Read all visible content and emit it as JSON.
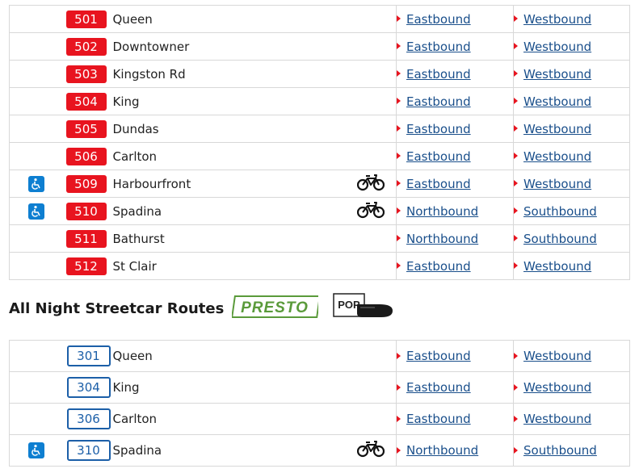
{
  "day_routes": [
    {
      "number": "501",
      "name": "Queen",
      "accessible": false,
      "bike": false,
      "dir1": "Eastbound",
      "dir2": "Westbound"
    },
    {
      "number": "502",
      "name": "Downtowner",
      "accessible": false,
      "bike": false,
      "dir1": "Eastbound",
      "dir2": "Westbound"
    },
    {
      "number": "503",
      "name": "Kingston Rd",
      "accessible": false,
      "bike": false,
      "dir1": "Eastbound",
      "dir2": "Westbound"
    },
    {
      "number": "504",
      "name": "King",
      "accessible": false,
      "bike": false,
      "dir1": "Eastbound",
      "dir2": "Westbound"
    },
    {
      "number": "505",
      "name": "Dundas",
      "accessible": false,
      "bike": false,
      "dir1": "Eastbound",
      "dir2": "Westbound"
    },
    {
      "number": "506",
      "name": "Carlton",
      "accessible": false,
      "bike": false,
      "dir1": "Eastbound",
      "dir2": "Westbound"
    },
    {
      "number": "509",
      "name": "Harbourfront",
      "accessible": true,
      "bike": true,
      "dir1": "Eastbound",
      "dir2": "Westbound"
    },
    {
      "number": "510",
      "name": "Spadina",
      "accessible": true,
      "bike": true,
      "dir1": "Northbound",
      "dir2": "Southbound"
    },
    {
      "number": "511",
      "name": "Bathurst",
      "accessible": false,
      "bike": false,
      "dir1": "Northbound",
      "dir2": "Southbound"
    },
    {
      "number": "512",
      "name": "St Clair",
      "accessible": false,
      "bike": false,
      "dir1": "Eastbound",
      "dir2": "Westbound"
    }
  ],
  "night_section": {
    "title": "All Night Streetcar Routes",
    "presto_logo_text": "PRESTO",
    "pop_logo_text": "POP"
  },
  "night_routes": [
    {
      "number": "301",
      "name": "Queen",
      "accessible": false,
      "bike": false,
      "dir1": "Eastbound",
      "dir2": "Westbound"
    },
    {
      "number": "304",
      "name": "King",
      "accessible": false,
      "bike": false,
      "dir1": "Eastbound",
      "dir2": "Westbound"
    },
    {
      "number": "306",
      "name": "Carlton",
      "accessible": false,
      "bike": false,
      "dir1": "Eastbound",
      "dir2": "Westbound"
    },
    {
      "number": "310",
      "name": "Spadina",
      "accessible": true,
      "bike": true,
      "dir1": "Northbound",
      "dir2": "Southbound"
    }
  ],
  "colors": {
    "day_badge": "#e8141f",
    "night_badge": "#1c5fa8",
    "accessible_icon": "#0e7fd1",
    "link": "#1a4f8b",
    "presto_green": "#5a9a3a"
  },
  "icons": {
    "accessible": "wheelchair-icon",
    "bike": "bicycle-icon",
    "direction": "red-triangle-arrow-icon"
  }
}
